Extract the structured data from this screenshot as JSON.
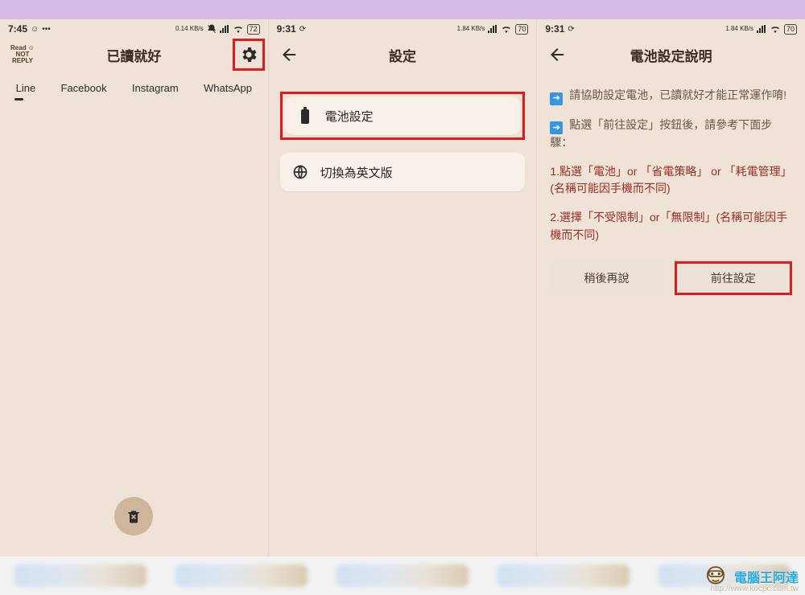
{
  "status": {
    "p1": {
      "clock": "7:45",
      "emoji": "☺",
      "dots": "•••",
      "net": "0.14 KB/s",
      "batt": "72"
    },
    "p2": {
      "clock": "9:31",
      "icon": "⟳",
      "net": "1.84 KB/s",
      "batt": "70"
    },
    "p3": {
      "clock": "9:31",
      "icon": "⟳",
      "net": "1.84 KB/s",
      "batt": "70"
    }
  },
  "screen1": {
    "logo_top": "Read ☺",
    "logo_bottom": "NOT REPLY",
    "title": "已讀就好",
    "tabs": [
      "Line",
      "Facebook",
      "Instagram",
      "WhatsApp"
    ]
  },
  "screen2": {
    "title": "設定",
    "battery": "電池設定",
    "lang": "切換為英文版"
  },
  "screen3": {
    "title": "電池設定說明",
    "line1": "請協助設定電池，已讀就好才能正常運作唷!",
    "line2": "點選「前往設定」按鈕後，請參考下面步驟：",
    "step1a": "1.點選「電池」or 「省電策略」 or 「耗電管理」",
    "step1b": "(名稱可能因手機而不同)",
    "step2": "2.選擇「不受限制」or「無限制」(名稱可能因手機而不同)",
    "later": "稍後再說",
    "go": "前往設定"
  },
  "watermark": {
    "text": "電腦王阿達",
    "url": "http://www.kocpc.com.tw"
  }
}
